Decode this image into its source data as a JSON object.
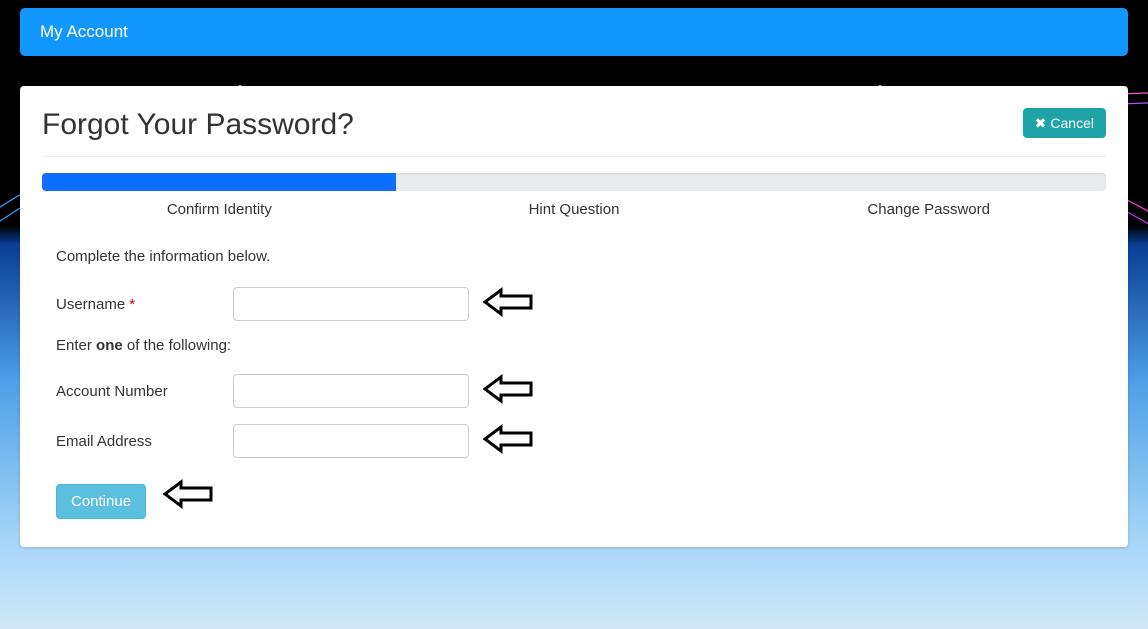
{
  "navbar": {
    "title": "My Account"
  },
  "panel": {
    "heading": "Forgot Your Password?",
    "cancel_label": "Cancel"
  },
  "progress": {
    "percent": 33.3,
    "steps": [
      {
        "label": "Confirm Identity"
      },
      {
        "label": "Hint Question"
      },
      {
        "label": "Change Password"
      }
    ]
  },
  "form": {
    "instruction": "Complete the information below.",
    "username_label": "Username",
    "username_value": "",
    "sub_instruction_pre": "Enter ",
    "sub_instruction_bold": "one",
    "sub_instruction_post": " of the following:",
    "account_number_label": "Account Number",
    "account_number_value": "",
    "email_label": "Email Address",
    "email_value": "",
    "continue_label": "Continue"
  }
}
